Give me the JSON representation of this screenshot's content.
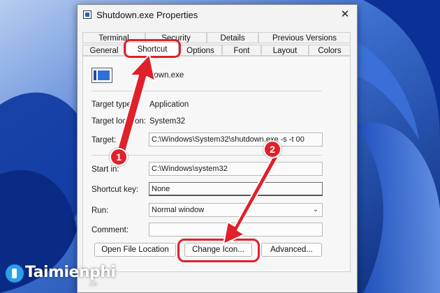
{
  "window": {
    "title": "Shutdown.exe Properties",
    "close_glyph": "✕"
  },
  "tabs_top": [
    "Terminal",
    "Security",
    "Details",
    "Previous Versions"
  ],
  "tabs_bottom": [
    "General",
    "Shortcut",
    "Options",
    "Font",
    "Layout",
    "Colors"
  ],
  "active_tab": "Shortcut",
  "shortcut": {
    "name_visible": "down.exe",
    "rows": {
      "target_type": {
        "label": "Target type:",
        "value": "Application"
      },
      "target_location": {
        "label": "Target location:",
        "value": "System32"
      },
      "target": {
        "label": "Target:",
        "value": "C:\\Windows\\System32\\shutdown.exe -s -t 00"
      },
      "start_in": {
        "label": "Start in:",
        "value": "C:\\Windows\\system32"
      },
      "shortcut_key": {
        "label": "Shortcut key:",
        "value": "None"
      },
      "run": {
        "label": "Run:",
        "value": "Normal window"
      },
      "comment": {
        "label": "Comment:",
        "value": ""
      }
    },
    "buttons": {
      "open_file_location": "Open File Location",
      "change_icon": "Change Icon...",
      "advanced": "Advanced..."
    }
  },
  "annotations": {
    "badge1": "1",
    "badge2": "2",
    "highlight_color": "#e0202a"
  },
  "watermark": {
    "brand": "Taimienphi",
    "suffix": ".vn"
  },
  "icons": [
    "app-icon",
    "close-icon",
    "chevron-down-icon",
    "shortcut-file-icon"
  ]
}
